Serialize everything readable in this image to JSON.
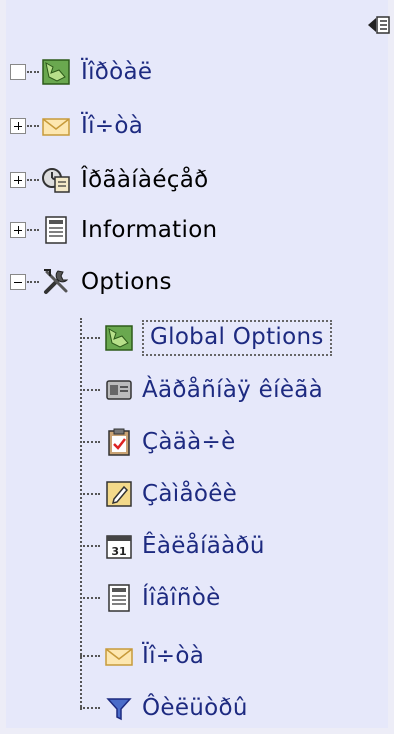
{
  "tree": {
    "collapse_icon": "collapse-panel-icon",
    "items": [
      {
        "label": "Ïîðòàë",
        "icon": "map-icon",
        "toggle": "empty"
      },
      {
        "label": "Ïî÷òà",
        "icon": "envelope-icon",
        "toggle": "plus"
      },
      {
        "label": "Îðãàíàéçåð",
        "icon": "organizer-icon",
        "toggle": "plus"
      },
      {
        "label": "Information",
        "icon": "document-icon",
        "toggle": "plus"
      },
      {
        "label": "Options",
        "icon": "tools-icon",
        "toggle": "minus"
      }
    ],
    "children": [
      {
        "label": "Global Options",
        "icon": "map-icon",
        "selected": true
      },
      {
        "label": "Àäðåñíàÿ êíèãà",
        "icon": "address-card-icon"
      },
      {
        "label": "Çàäà÷è",
        "icon": "clipboard-icon"
      },
      {
        "label": "Çàìåòêè",
        "icon": "notepad-icon"
      },
      {
        "label": "Êàëåíäàðü",
        "icon": "calendar-icon"
      },
      {
        "label": "Íîâîñòè",
        "icon": "news-icon"
      },
      {
        "label": "Ïî÷òà",
        "icon": "envelope-icon"
      },
      {
        "label": "Ôèëüòðû",
        "icon": "filter-icon"
      }
    ]
  }
}
